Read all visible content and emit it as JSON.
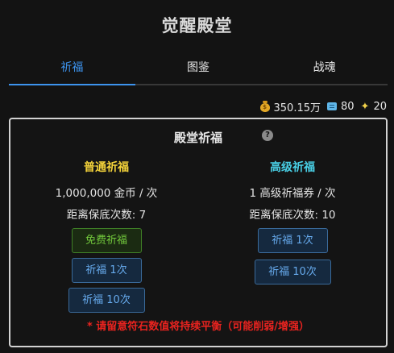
{
  "page_title": "觉醒殿堂",
  "tabs": [
    {
      "label": "祈福",
      "active": true
    },
    {
      "label": "图鉴",
      "active": false
    },
    {
      "label": "战魂",
      "active": false
    }
  ],
  "resources": {
    "gold": "350.15万",
    "tickets": "80",
    "stones": "20"
  },
  "panel": {
    "title": "殿堂祈福",
    "help_symbol": "?",
    "normal": {
      "title": "普通祈福",
      "cost": "1,000,000 金币 / 次",
      "pity": "距离保底次数: 7",
      "free_label": "免费祈福",
      "one_label": "祈福 1次",
      "ten_label": "祈福 10次"
    },
    "advanced": {
      "title": "高级祈福",
      "cost": "1 高级祈福券 / 次",
      "pity": "距离保底次数: 10",
      "one_label": "祈福 1次",
      "ten_label": "祈福 10次"
    },
    "notice": "* 请留意符石数值将持续平衡（可能削弱/增强）"
  },
  "colors": {
    "accent": "#3d93ee",
    "normal_title": "#f4d33a",
    "advanced_title": "#49d0e6",
    "free_button": "#72c83c",
    "notice": "#e8231f"
  },
  "icons": {
    "gold": "money-bag-icon",
    "tickets": "ticket-icon",
    "stones": "sparkle-icon",
    "help": "help-icon"
  }
}
